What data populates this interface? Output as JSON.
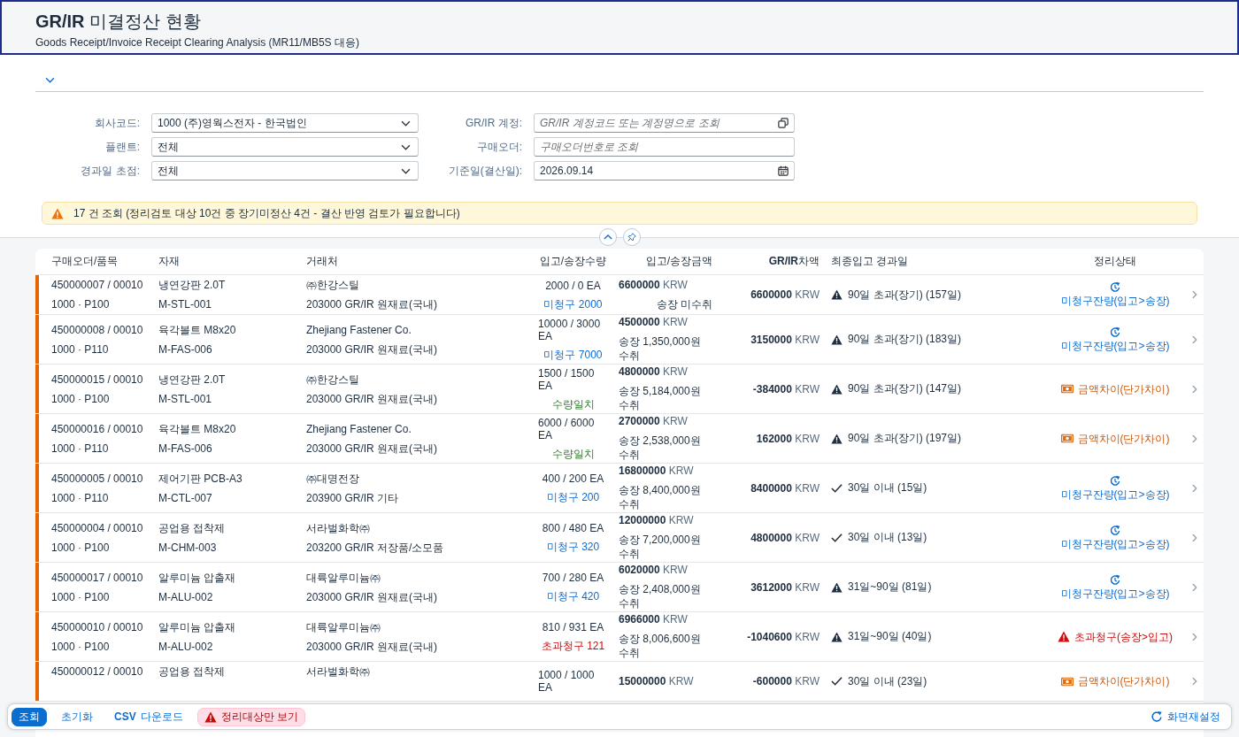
{
  "header": {
    "title": "**GR/IR** 미결정산 현황",
    "subtitle": "Goods Receipt/Invoice Receipt Clearing Analysis (MR11/MB5S 대응)"
  },
  "filters": [
    {
      "label": "회사코드:",
      "kind": "select",
      "value": "1000 (주)영웍스전자 - 한국법인"
    },
    {
      "label": "GR/IR 계정:",
      "kind": "value_help",
      "placeholder": "GR/IR 계정코드 또는 계정명으로 조회"
    },
    {
      "label": "플랜트:",
      "kind": "select",
      "value": "전체"
    },
    {
      "label": "구매오더:",
      "kind": "input",
      "placeholder": "구매오더번호로 조회"
    },
    {
      "label": "경과일 초점:",
      "kind": "select",
      "value": "전체"
    },
    {
      "label": "기준일(결산일):",
      "kind": "date",
      "value": "2026.09.14"
    }
  ],
  "message": {
    "kind": "warning",
    "text": "17 건 조회 (정리검토 대상 10건 중 장기미정산 4건 - 결산 반영 검토가 필요합니다)"
  },
  "table": {
    "columns": [
      "구매오더/품목",
      "자재",
      "거래처",
      "입고/송장수량",
      "입고/송장금액",
      "**GR/IR**차액",
      "최종입고 경과일",
      "정리상태"
    ],
    "rows": [
      {
        "flagged": true,
        "po": "450000007 / 00010",
        "plant": "1000 · P100",
        "material": "냉연강판 2.0T",
        "material_code": "M-STL-001",
        "vendor": "㈜한강스틸",
        "account": "203000 GR/IR 원재료(국내)",
        "quantity": "2000 / 0 EA",
        "quantity_status": {
          "kind": "open",
          "text": "미청구 2000"
        },
        "amount": {
          "value": "6600000",
          "unit": "KRW"
        },
        "invoice": {
          "received": false,
          "text": "송장 미수취"
        },
        "difference": {
          "value": "6600000",
          "unit": "KRW"
        },
        "age": {
          "kind": "warning",
          "text": "90일 초과(장기) (157일)"
        },
        "status": {
          "kind": "open",
          "text": "미청구잔량(입고>송장)"
        }
      },
      {
        "flagged": true,
        "po": "450000008 / 00010",
        "plant": "1000 · P110",
        "material": "육각볼트 M8x20",
        "material_code": "M-FAS-006",
        "vendor": "Zhejiang Fastener Co.",
        "account": "203000 GR/IR 원재료(국내)",
        "quantity": "10000 / 3000 EA",
        "quantity_status": {
          "kind": "open",
          "text": "미청구 7000"
        },
        "amount": {
          "value": "4500000",
          "unit": "KRW"
        },
        "invoice": {
          "received": true,
          "text": "송장 1,350,000원 수취"
        },
        "difference": {
          "value": "3150000",
          "unit": "KRW"
        },
        "age": {
          "kind": "warning",
          "text": "90일 초과(장기) (183일)"
        },
        "status": {
          "kind": "open",
          "text": "미청구잔량(입고>송장)"
        }
      },
      {
        "flagged": true,
        "po": "450000015 / 00010",
        "plant": "1000 · P100",
        "material": "냉연강판 2.0T",
        "material_code": "M-STL-001",
        "vendor": "㈜한강스틸",
        "account": "203000 GR/IR 원재료(국내)",
        "quantity": "1500 / 1500 EA",
        "quantity_status": {
          "kind": "match",
          "text": "수량일치"
        },
        "amount": {
          "value": "4800000",
          "unit": "KRW"
        },
        "invoice": {
          "received": true,
          "text": "송장 5,184,000원 수취"
        },
        "difference": {
          "value": "-384000",
          "unit": "KRW"
        },
        "age": {
          "kind": "warning",
          "text": "90일 초과(장기) (147일)"
        },
        "status": {
          "kind": "price",
          "text": "금액차이(단가차이)"
        }
      },
      {
        "flagged": true,
        "po": "450000016 / 00010",
        "plant": "1000 · P110",
        "material": "육각볼트 M8x20",
        "material_code": "M-FAS-006",
        "vendor": "Zhejiang Fastener Co.",
        "account": "203000 GR/IR 원재료(국내)",
        "quantity": "6000 / 6000 EA",
        "quantity_status": {
          "kind": "match",
          "text": "수량일치"
        },
        "amount": {
          "value": "2700000",
          "unit": "KRW"
        },
        "invoice": {
          "received": true,
          "text": "송장 2,538,000원 수취"
        },
        "difference": {
          "value": "162000",
          "unit": "KRW"
        },
        "age": {
          "kind": "warning",
          "text": "90일 초과(장기) (197일)"
        },
        "status": {
          "kind": "price",
          "text": "금액차이(단가차이)"
        }
      },
      {
        "flagged": true,
        "po": "450000005 / 00010",
        "plant": "1000 · P110",
        "material": "제어기판 PCB-A3",
        "material_code": "M-CTL-007",
        "vendor": "㈜대명전장",
        "account": "203900 GR/IR 기타",
        "quantity": "400 / 200 EA",
        "quantity_status": {
          "kind": "open",
          "text": "미청구 200"
        },
        "amount": {
          "value": "16800000",
          "unit": "KRW"
        },
        "invoice": {
          "received": true,
          "text": "송장 8,400,000원 수취"
        },
        "difference": {
          "value": "8400000",
          "unit": "KRW"
        },
        "age": {
          "kind": "ok",
          "text": "30일 이내 (15일)"
        },
        "status": {
          "kind": "open",
          "text": "미청구잔량(입고>송장)"
        }
      },
      {
        "flagged": true,
        "po": "450000004 / 00010",
        "plant": "1000 · P100",
        "material": "공업용 접착제",
        "material_code": "M-CHM-003",
        "vendor": "서라벌화학㈜",
        "account": "203200 GR/IR 저장품/소모품",
        "quantity": "800 / 480 EA",
        "quantity_status": {
          "kind": "open",
          "text": "미청구 320"
        },
        "amount": {
          "value": "12000000",
          "unit": "KRW"
        },
        "invoice": {
          "received": true,
          "text": "송장 7,200,000원 수취"
        },
        "difference": {
          "value": "4800000",
          "unit": "KRW"
        },
        "age": {
          "kind": "ok",
          "text": "30일 이내 (13일)"
        },
        "status": {
          "kind": "open",
          "text": "미청구잔량(입고>송장)"
        }
      },
      {
        "flagged": true,
        "po": "450000017 / 00010",
        "plant": "1000 · P100",
        "material": "알루미늄 압출재",
        "material_code": "M-ALU-002",
        "vendor": "대륙알루미늄㈜",
        "account": "203000 GR/IR 원재료(국내)",
        "quantity": "700 / 280 EA",
        "quantity_status": {
          "kind": "open",
          "text": "미청구 420"
        },
        "amount": {
          "value": "6020000",
          "unit": "KRW"
        },
        "invoice": {
          "received": true,
          "text": "송장 2,408,000원 수취"
        },
        "difference": {
          "value": "3612000",
          "unit": "KRW"
        },
        "age": {
          "kind": "warning",
          "text": "31일~90일 (81일)"
        },
        "status": {
          "kind": "open",
          "text": "미청구잔량(입고>송장)"
        }
      },
      {
        "flagged": true,
        "po": "450000010 / 00010",
        "plant": "1000 · P100",
        "material": "알루미늄 압출재",
        "material_code": "M-ALU-002",
        "vendor": "대륙알루미늄㈜",
        "account": "203000 GR/IR 원재료(국내)",
        "quantity": "810 / 931 EA",
        "quantity_status": {
          "kind": "over",
          "text": "초과청구 121"
        },
        "amount": {
          "value": "6966000",
          "unit": "KRW"
        },
        "invoice": {
          "received": true,
          "text": "송장 8,006,600원 수취"
        },
        "difference": {
          "value": "-1040600",
          "unit": "KRW"
        },
        "age": {
          "kind": "warning",
          "text": "31일~90일 (40일)"
        },
        "status": {
          "kind": "over",
          "text": "초과청구(송장>입고)"
        }
      },
      {
        "flagged": true,
        "po": "450000012 / 00010",
        "material": "공업용 접착제",
        "vendor": "서라벌화학㈜",
        "quantity": "1000 / 1000 EA",
        "amount": {
          "value": "15000000",
          "unit": "KRW"
        },
        "difference": {
          "value": "-600000",
          "unit": "KRW"
        },
        "age": {
          "kind": "ok",
          "text": "30일 이내 (23일)"
        },
        "status": {
          "kind": "price",
          "text": "금액차이(단가차이)"
        }
      }
    ]
  },
  "footer": {
    "actions": [
      {
        "kind": "emphasized",
        "label": "조회"
      },
      {
        "kind": "transparent",
        "label": "초기화"
      },
      {
        "kind": "transparent",
        "label": "**CSV** 다운로드"
      }
    ],
    "toggle": {
      "label": "정리대상만 보기",
      "on": true
    },
    "reset": "화면재설정"
  }
}
